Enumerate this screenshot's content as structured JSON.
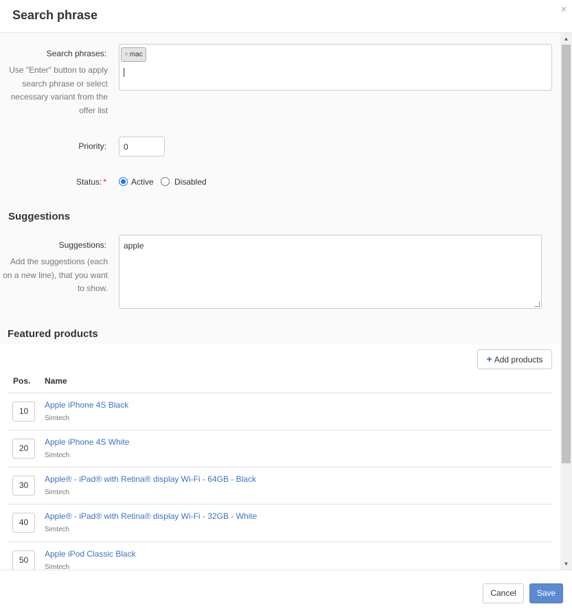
{
  "dialog": {
    "title": "Search phrase",
    "close_glyph": "×"
  },
  "search_phrases": {
    "label": "Search phrases:",
    "help": "Use \"Enter\" button to apply search phrase or select necessary variant from the offer list",
    "tags": [
      {
        "remove": "×",
        "text": "mac"
      }
    ]
  },
  "priority": {
    "label": "Priority:",
    "value": "0"
  },
  "status": {
    "label": "Status:",
    "required_mark": "*",
    "options": [
      {
        "label": "Active",
        "checked": true
      },
      {
        "label": "Disabled",
        "checked": false
      }
    ]
  },
  "suggestions_section": {
    "title": "Suggestions",
    "label": "Suggestions:",
    "help": "Add the suggestions (each on a new line), that you want to show.",
    "value": "apple"
  },
  "featured": {
    "title": "Featured products",
    "add_label": "Add products",
    "columns": {
      "pos": "Pos.",
      "name": "Name"
    },
    "rows": [
      {
        "pos": "10",
        "name": "Apple iPhone 4S Black",
        "vendor": "Simtech"
      },
      {
        "pos": "20",
        "name": "Apple iPhone 4S White",
        "vendor": "Simtech"
      },
      {
        "pos": "30",
        "name": "Apple® - iPad® with Retina® display Wi-Fi - 64GB - Black",
        "vendor": "Simtech"
      },
      {
        "pos": "40",
        "name": "Apple® - iPad® with Retina® display Wi-Fi - 32GB - White",
        "vendor": "Simtech"
      },
      {
        "pos": "50",
        "name": "Apple iPod Classic Black",
        "vendor": "Simtech"
      }
    ]
  },
  "footer": {
    "cancel_label": "Cancel",
    "save_label": "Save"
  },
  "colors": {
    "link": "#3d74c4",
    "primary_button": "#5b8ad0",
    "required": "#e02424",
    "radio_checked": "#1a73e8"
  }
}
